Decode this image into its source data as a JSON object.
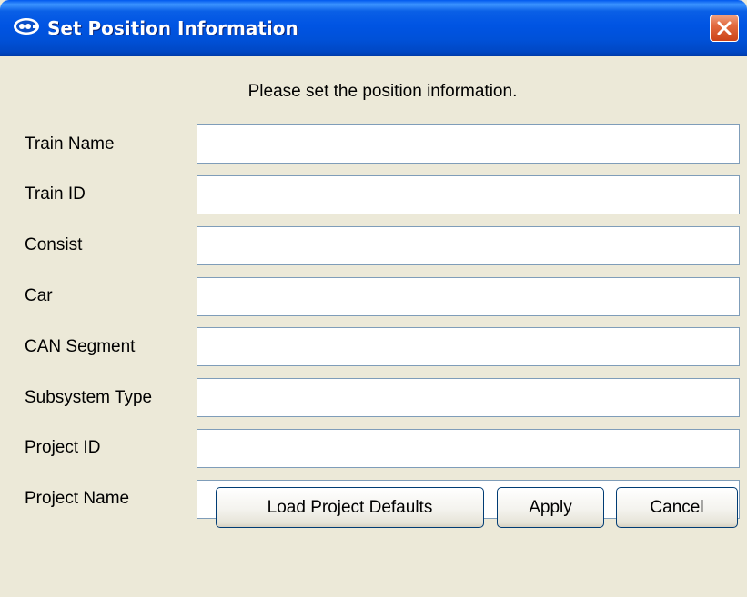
{
  "window": {
    "title": "Set Position Information",
    "icon": "app-logo-icon",
    "close": "close-icon"
  },
  "dialog": {
    "prompt": "Please set the position information."
  },
  "fields": [
    {
      "label": "Train Name",
      "value": ""
    },
    {
      "label": "Train ID",
      "value": ""
    },
    {
      "label": "Consist",
      "value": ""
    },
    {
      "label": "Car",
      "value": ""
    },
    {
      "label": "CAN Segment",
      "value": ""
    },
    {
      "label": "Subsystem Type",
      "value": ""
    },
    {
      "label": "Project ID",
      "value": ""
    },
    {
      "label": "Project Name",
      "value": ""
    }
  ],
  "buttons": {
    "load_defaults": "Load Project Defaults",
    "apply": "Apply",
    "cancel": "Cancel"
  },
  "colors": {
    "titlebar": "#0054e3",
    "dialog_bg": "#ece9d8",
    "field_border": "#7f9db9",
    "close_button": "#e2693e"
  }
}
